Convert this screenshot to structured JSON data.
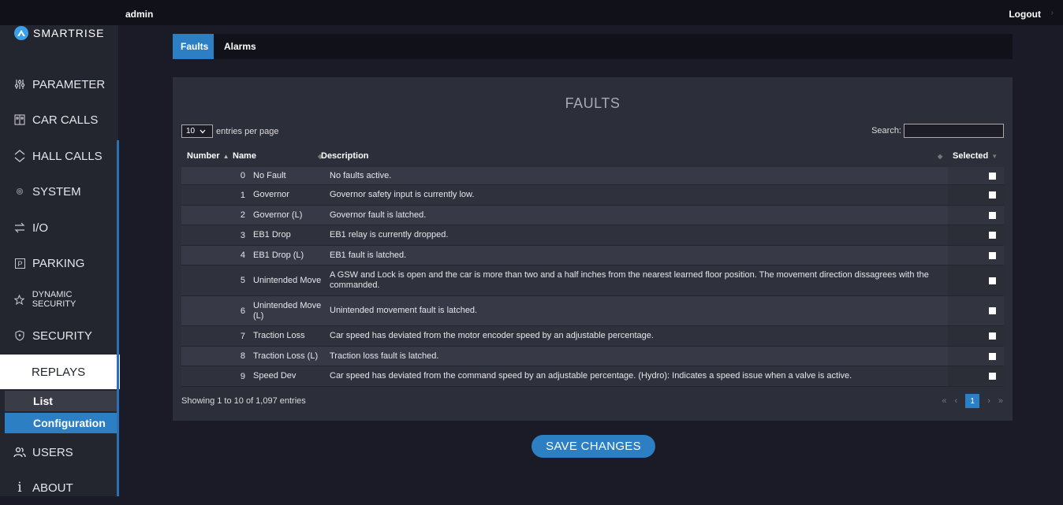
{
  "topbar": {
    "user": "admin",
    "logout": "Logout"
  },
  "brand": {
    "name": "SMARTRISE"
  },
  "sidebar": {
    "items": [
      {
        "label": "PARAMETER",
        "icon": "sliders-icon"
      },
      {
        "label": "CAR CALLS",
        "icon": "car-panel-icon"
      },
      {
        "label": "HALL CALLS",
        "icon": "up-down-chevrons-icon"
      },
      {
        "label": "SYSTEM",
        "icon": "gear-icon"
      },
      {
        "label": "I/O",
        "icon": "swap-arrows-icon"
      },
      {
        "label": "PARKING",
        "icon": "parking-icon"
      },
      {
        "label": "DYNAMIC SECURITY",
        "icon": "star-icon"
      },
      {
        "label": "SECURITY",
        "icon": "shield-icon"
      },
      {
        "label": "REPLAYS",
        "icon": ""
      },
      {
        "label": "USERS",
        "icon": "users-icon"
      },
      {
        "label": "ABOUT",
        "icon": "info-icon"
      }
    ],
    "sub_items": {
      "list": "List",
      "configuration": "Configuration"
    }
  },
  "tabs": {
    "faults": "Faults",
    "alarms": "Alarms"
  },
  "panel": {
    "title": "FAULTS",
    "entries_value": "10",
    "entries_label": "entries per page",
    "search_label": "Search:",
    "search_value": "",
    "columns": {
      "number": "Number",
      "name": "Name",
      "description": "Description",
      "selected": "Selected"
    },
    "rows": [
      {
        "number": "0",
        "name": "No Fault",
        "description": "No faults active."
      },
      {
        "number": "1",
        "name": "Governor",
        "description": "Governor safety input is currently low."
      },
      {
        "number": "2",
        "name": "Governor (L)",
        "description": "Governor fault is latched."
      },
      {
        "number": "3",
        "name": "EB1 Drop",
        "description": "EB1 relay is currently dropped."
      },
      {
        "number": "4",
        "name": "EB1 Drop (L)",
        "description": "EB1 fault is latched."
      },
      {
        "number": "5",
        "name": "Unintended Move",
        "description": "A GSW and Lock is open and the car is more than two and a half inches from the nearest learned floor position. The movement direction dissagrees with the commanded."
      },
      {
        "number": "6",
        "name": "Unintended Move (L)",
        "description": "Unintended movement fault is latched."
      },
      {
        "number": "7",
        "name": "Traction Loss",
        "description": "Car speed has deviated from the motor encoder speed by an adjustable percentage."
      },
      {
        "number": "8",
        "name": "Traction Loss (L)",
        "description": "Traction loss fault is latched."
      },
      {
        "number": "9",
        "name": "Speed Dev",
        "description": "Car speed has deviated from the command speed by an adjustable percentage. (Hydro): Indicates a speed issue when a valve is active."
      }
    ],
    "showing": "Showing 1 to 10 of 1,097 entries",
    "pager": {
      "first": "«",
      "prev": "‹",
      "current": "1",
      "next": "›",
      "last": "»"
    }
  },
  "save_label": "SAVE CHANGES",
  "colors": {
    "accent": "#2d7fc4",
    "background": "#1a1b26",
    "panel": "#2c2e39",
    "sidebar": "#23252f"
  }
}
